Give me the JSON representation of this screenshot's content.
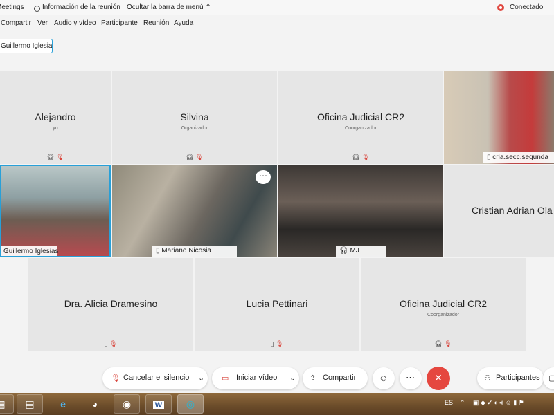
{
  "topbar": {
    "app": "Meetings",
    "info": "Información de la reunión",
    "hide_menu": "Ocultar la barra de menú",
    "status": "Conectado"
  },
  "menu": [
    "Compartir",
    "Ver",
    "Audio y vídeo",
    "Participante",
    "Reunión",
    "Ayuda"
  ],
  "presenter_chip": "Guillermo Iglesias",
  "tiles": {
    "alejandro": {
      "name": "Alejandro",
      "role": "yo"
    },
    "silvina": {
      "name": "Silvina",
      "role": "Organizador"
    },
    "oficina1": {
      "name": "Oficina Judicial CR2",
      "role": "Coorganizador"
    },
    "cria": {
      "label": "cria.secc.segunda"
    },
    "guillermo": {
      "label": "Guillermo Iglesias"
    },
    "mariano": {
      "label": "Mariano Nicosia"
    },
    "mj": {
      "label": "MJ"
    },
    "cristian": {
      "name": "Cristian Adrian Ola"
    },
    "alicia": {
      "name": "Dra. Alicia Dramesino"
    },
    "lucia": {
      "name": "Lucia Pettinari"
    },
    "oficina2": {
      "name": "Oficina Judicial CR2",
      "role": "Coorganizador"
    }
  },
  "toolbar": {
    "unmute": "Cancelar el silencio",
    "start_video": "Iniciar vídeo",
    "share": "Compartir",
    "participants": "Participantes"
  },
  "taskbar": {
    "lang": "ES",
    "apps": [
      "windows-start",
      "file-explorer",
      "internet-explorer",
      "paint",
      "chrome",
      "word",
      "webex"
    ]
  },
  "colors": {
    "accent": "#28a0d8",
    "mute": "#d9443b",
    "end": "#e5473f"
  }
}
